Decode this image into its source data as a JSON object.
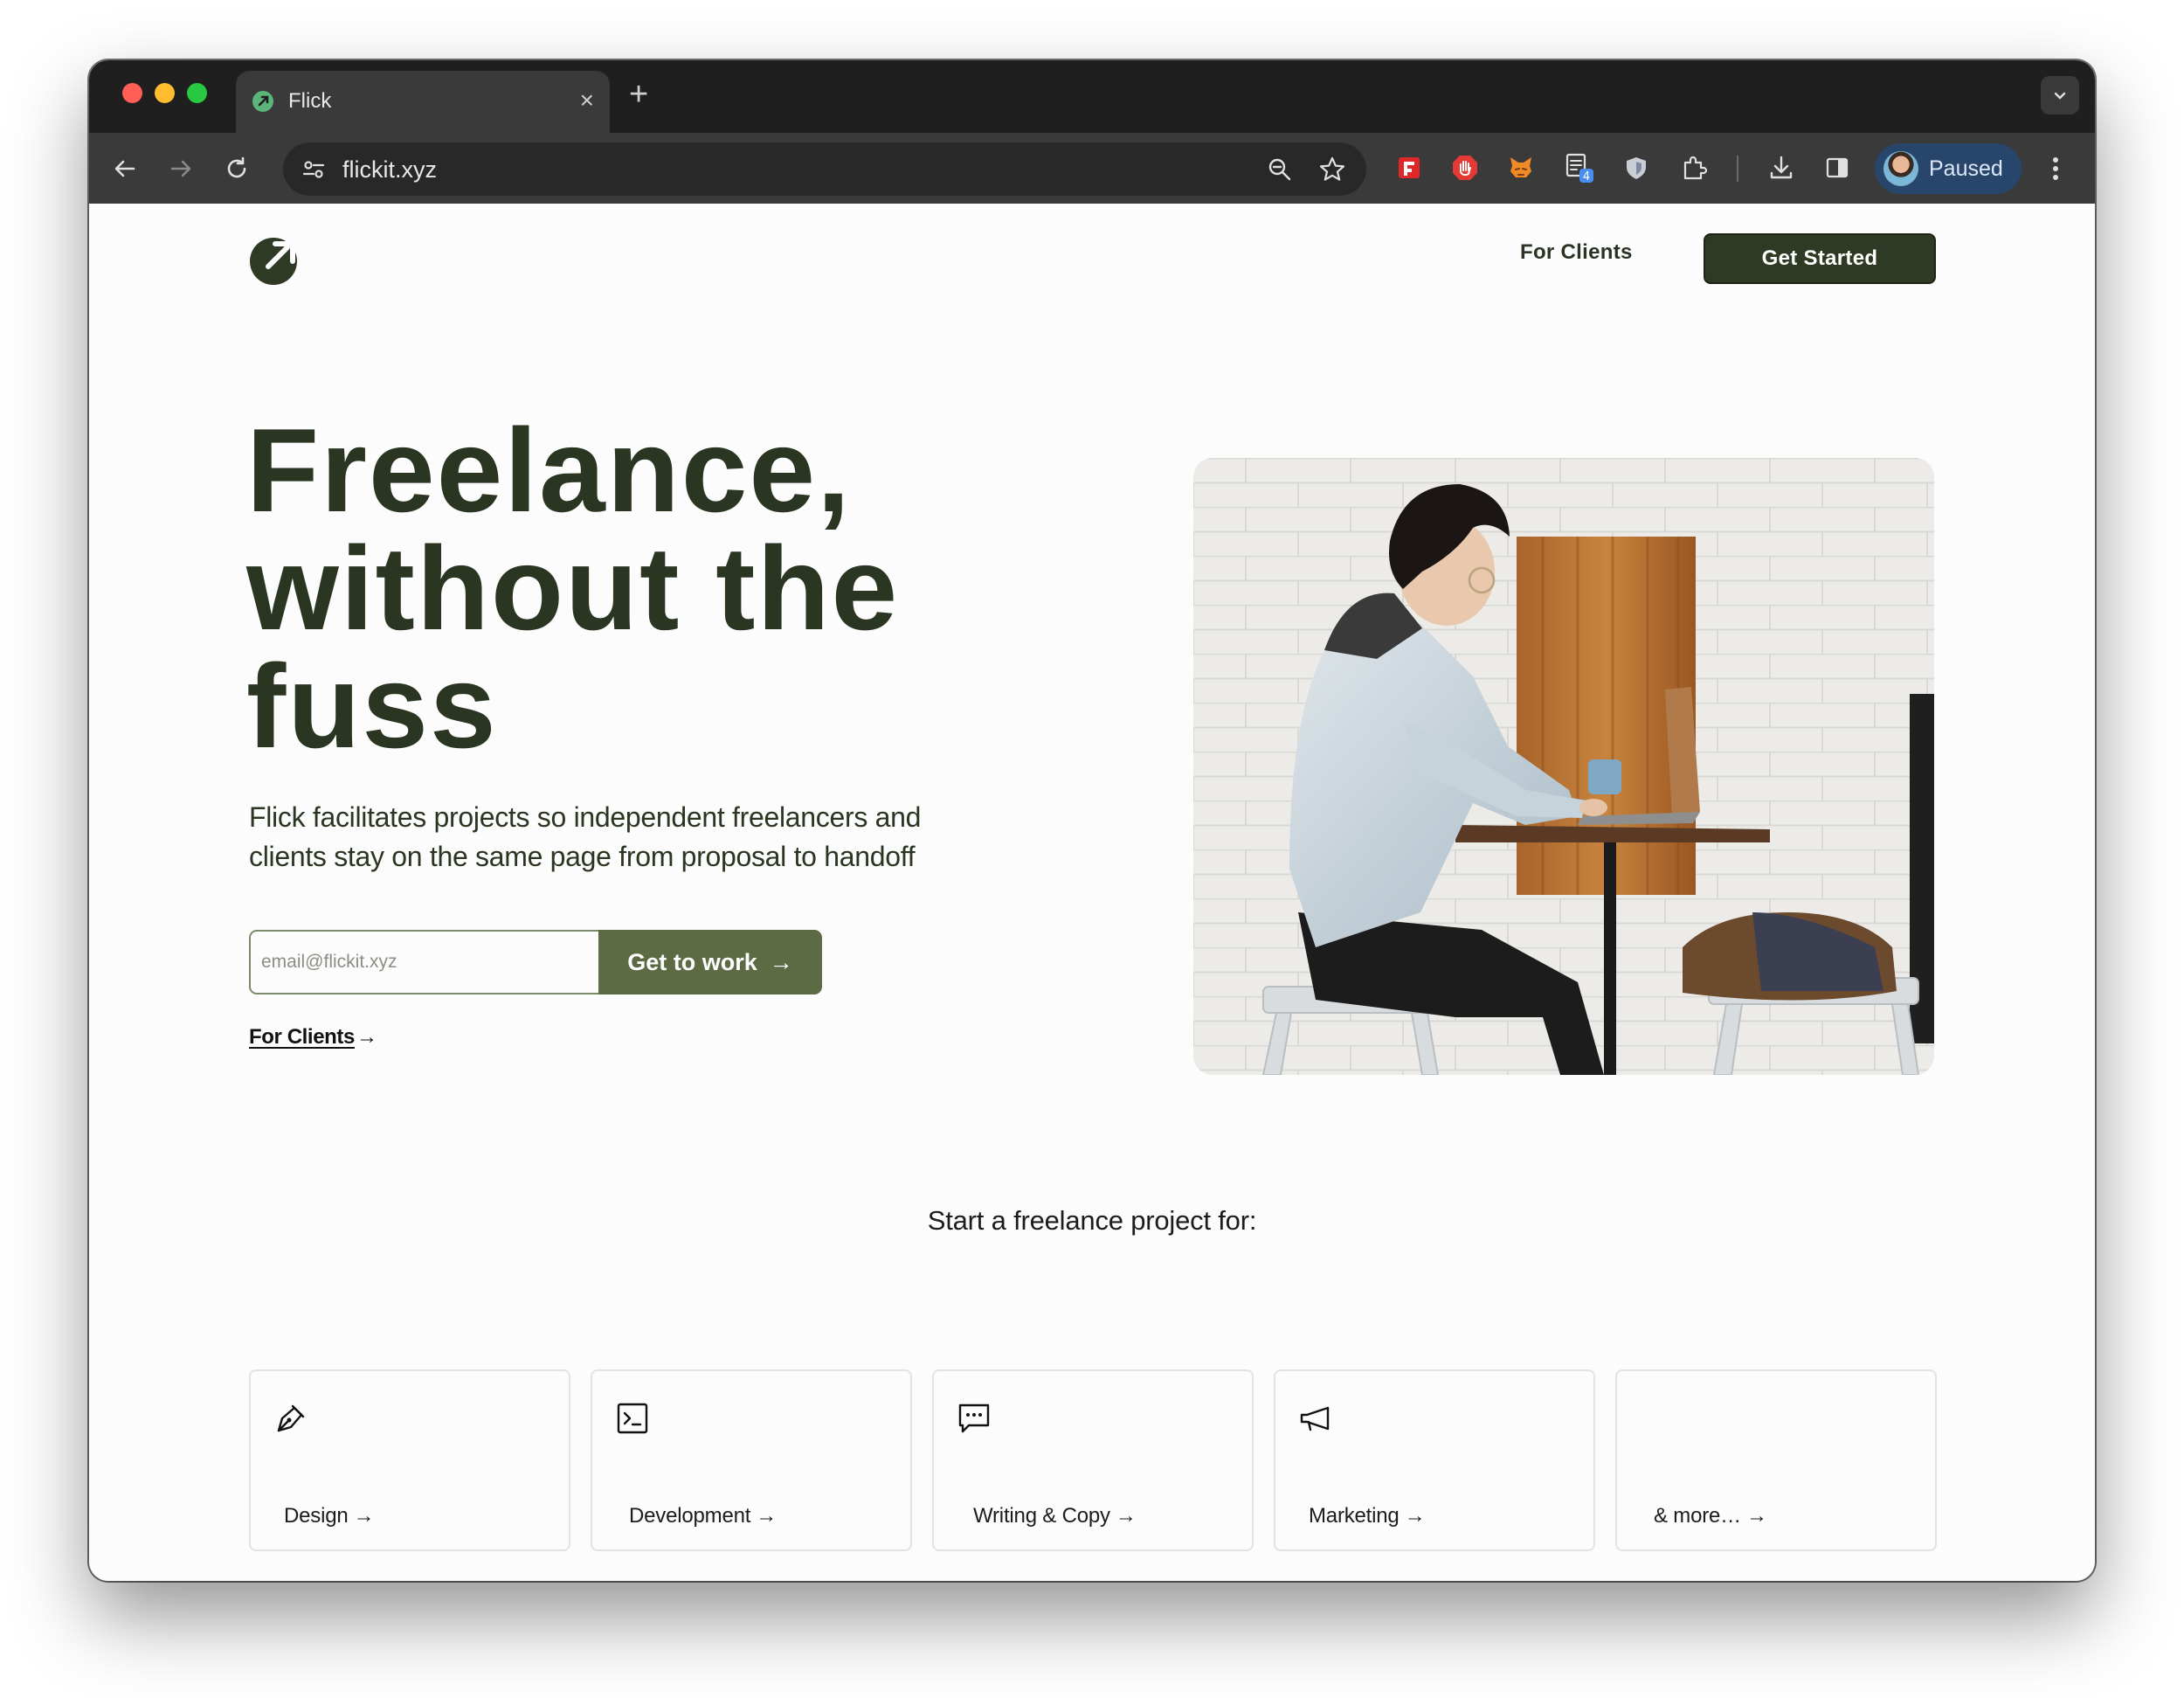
{
  "browser": {
    "tab_title": "Flick",
    "tab_close": "×",
    "new_tab": "+",
    "url": "flickit.xyz",
    "profile_label": "Paused",
    "extension_badge": "4"
  },
  "header": {
    "nav_link": "For Clients",
    "cta_label": "Get Started"
  },
  "hero": {
    "title_line1": "Freelance,",
    "title_line2": "without the",
    "title_line3": "fuss",
    "subtitle_line1": "Flick facilitates projects so independent freelancers and",
    "subtitle_line2": "clients stay on the same page from proposal to handoff",
    "email_placeholder": "email@flickit.xyz",
    "cta_label": "Get to work",
    "cta_arrow": "→",
    "secondary_link": "For Clients",
    "secondary_arrow": "→"
  },
  "categories": {
    "heading": "Start a freelance project for:",
    "items": [
      {
        "label": "Design",
        "arrow": "→",
        "icon": "pen-nib-icon"
      },
      {
        "label": "Development",
        "arrow": "→",
        "icon": "terminal-icon"
      },
      {
        "label": "Writing & Copy",
        "arrow": "→",
        "icon": "chat-bubble-icon"
      },
      {
        "label": "Marketing",
        "arrow": "→",
        "icon": "megaphone-icon"
      },
      {
        "label": "& more…",
        "arrow": "→",
        "icon": ""
      }
    ]
  },
  "colors": {
    "brand_dark": "#2f3a25",
    "brand_olive": "#5c6b43",
    "text_dark": "#2b3622"
  }
}
